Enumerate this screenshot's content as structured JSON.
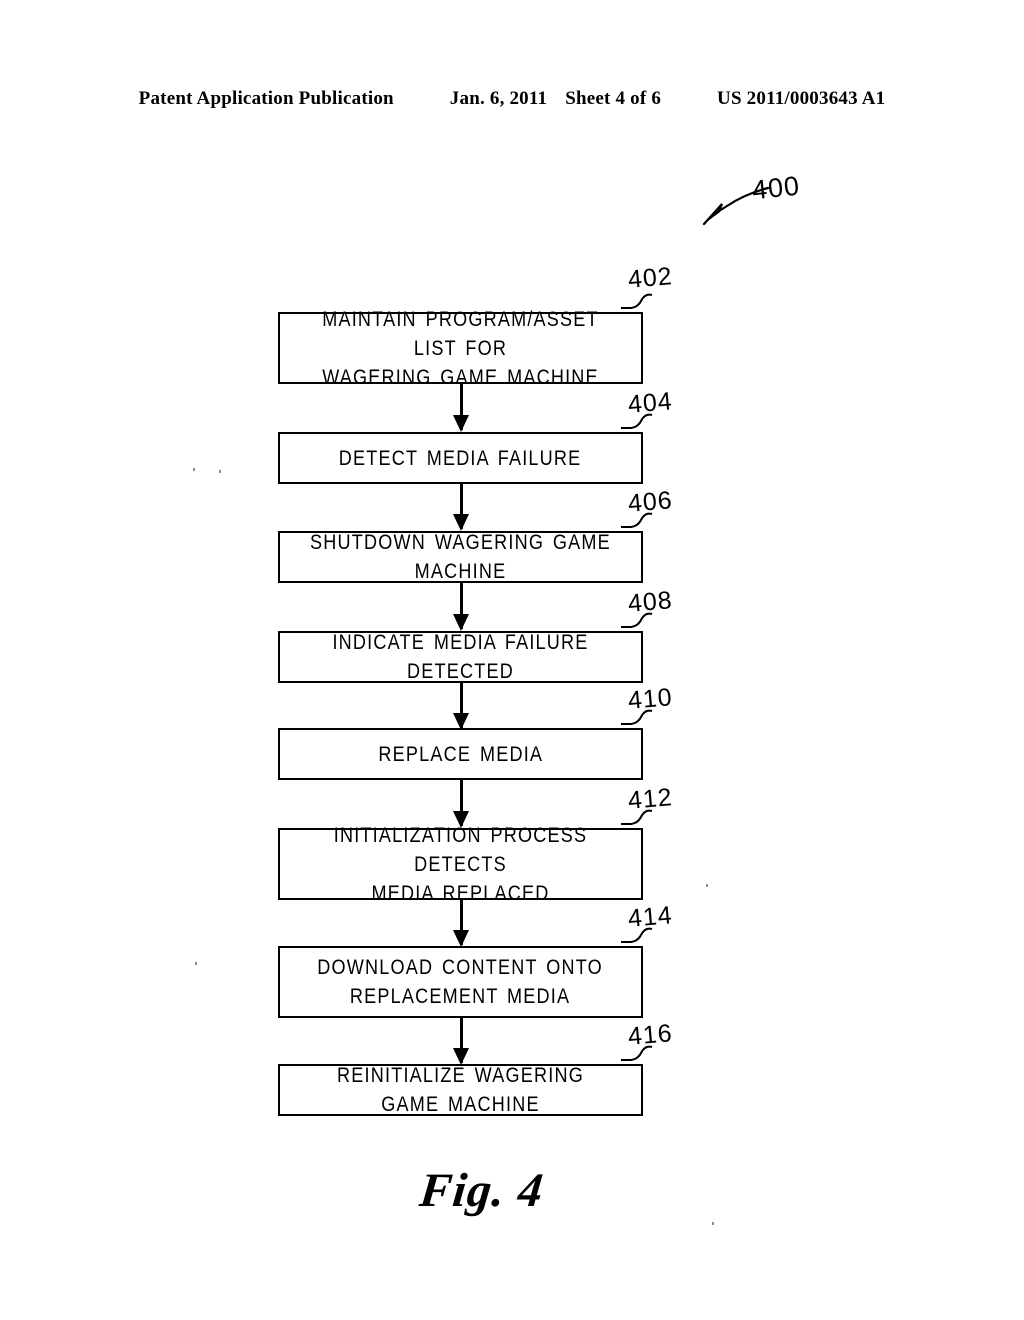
{
  "header": {
    "publication": "Patent Application Publication",
    "date": "Jan. 6, 2011",
    "sheet": "Sheet 4 of 6",
    "patent_number": "US 2011/0003643 A1"
  },
  "figure": {
    "overall_ref": "400",
    "caption": "Fig. 4"
  },
  "chart_data": {
    "type": "diagram",
    "diagram_kind": "flowchart",
    "title": "Fig. 4",
    "overall_ref": "400",
    "orientation": "vertical",
    "nodes": [
      {
        "ref": "402",
        "text": "MAINTAIN PROGRAM/ASSET LIST FOR\nWAGERING GAME MACHINE",
        "lines": 2
      },
      {
        "ref": "404",
        "text": "DETECT MEDIA FAILURE",
        "lines": 1
      },
      {
        "ref": "406",
        "text": "SHUTDOWN WAGERING GAME MACHINE",
        "lines": 1
      },
      {
        "ref": "408",
        "text": "INDICATE MEDIA FAILURE DETECTED",
        "lines": 1
      },
      {
        "ref": "410",
        "text": "REPLACE MEDIA",
        "lines": 1
      },
      {
        "ref": "412",
        "text": "INITIALIZATION PROCESS DETECTS\nMEDIA REPLACED",
        "lines": 2
      },
      {
        "ref": "414",
        "text": "DOWNLOAD CONTENT ONTO\nREPLACEMENT MEDIA",
        "lines": 2
      },
      {
        "ref": "416",
        "text": "REINITIALIZE WAGERING GAME MACHINE",
        "lines": 1
      }
    ],
    "edges": [
      {
        "from": "402",
        "to": "404",
        "arrow": "down"
      },
      {
        "from": "404",
        "to": "406",
        "arrow": "down"
      },
      {
        "from": "406",
        "to": "408",
        "arrow": "down"
      },
      {
        "from": "408",
        "to": "410",
        "arrow": "down"
      },
      {
        "from": "410",
        "to": "412",
        "arrow": "down"
      },
      {
        "from": "412",
        "to": "414",
        "arrow": "down"
      },
      {
        "from": "414",
        "to": "416",
        "arrow": "down"
      }
    ],
    "colors": {
      "ink": "#000000",
      "paper": "#ffffff"
    }
  }
}
